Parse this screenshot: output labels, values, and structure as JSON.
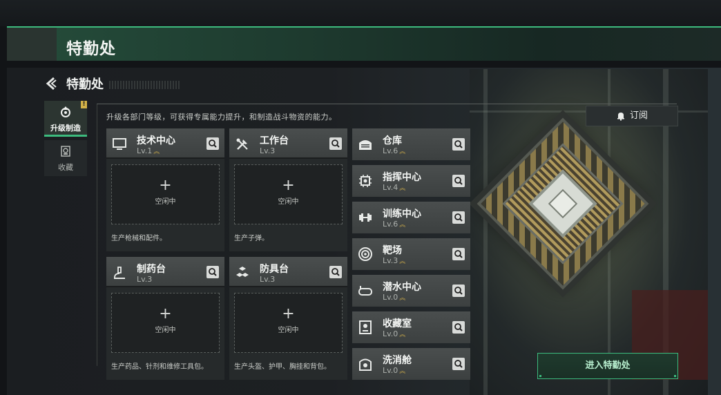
{
  "header": {
    "title": "特勤处"
  },
  "breadcrumb": {
    "label": "特勤处"
  },
  "side_tabs": [
    {
      "label": "升级制造",
      "active": true,
      "alert": "!"
    },
    {
      "label": "收藏",
      "active": false
    }
  ],
  "description": "升级各部门等级，可获得专属能力提升，和制造战斗物资的能力。",
  "subscribe": {
    "label": "订阅"
  },
  "workshops": [
    {
      "name": "技术中心",
      "level": "Lv.1",
      "icon": "monitor-icon",
      "slot_status": "空闲中",
      "product": "生产枪械和配件。"
    },
    {
      "name": "工作台",
      "level": "Lv.3",
      "icon": "tools-icon",
      "slot_status": "空闲中",
      "product": "生产子弹。"
    },
    {
      "name": "制药台",
      "level": "Lv.3",
      "icon": "microscope-icon",
      "slot_status": "空闲中",
      "product": "生产药品、针剂和维修工具包。"
    },
    {
      "name": "防具台",
      "level": "Lv.3",
      "icon": "armor-blocks-icon",
      "slot_status": "空闲中",
      "product": "生产头盔、护甲、胸挂和背包。"
    }
  ],
  "facilities": [
    {
      "name": "仓库",
      "level": "Lv.6",
      "icon": "warehouse-icon"
    },
    {
      "name": "指挥中心",
      "level": "Lv.4",
      "icon": "chip-icon"
    },
    {
      "name": "训练中心",
      "level": "Lv.6",
      "icon": "dumbbell-icon"
    },
    {
      "name": "靶场",
      "level": "Lv.3",
      "icon": "target-icon"
    },
    {
      "name": "潜水中心",
      "level": "Lv.0",
      "icon": "dive-mask-icon"
    },
    {
      "name": "收藏室",
      "level": "Lv.0",
      "icon": "vault-icon"
    },
    {
      "name": "洗消舱",
      "level": "Lv.0",
      "icon": "decon-icon"
    }
  ],
  "enter_button": {
    "label": "进入特勤处"
  },
  "colors": {
    "accent": "#3dbb7e",
    "level_chevron": "#c8a84a"
  }
}
